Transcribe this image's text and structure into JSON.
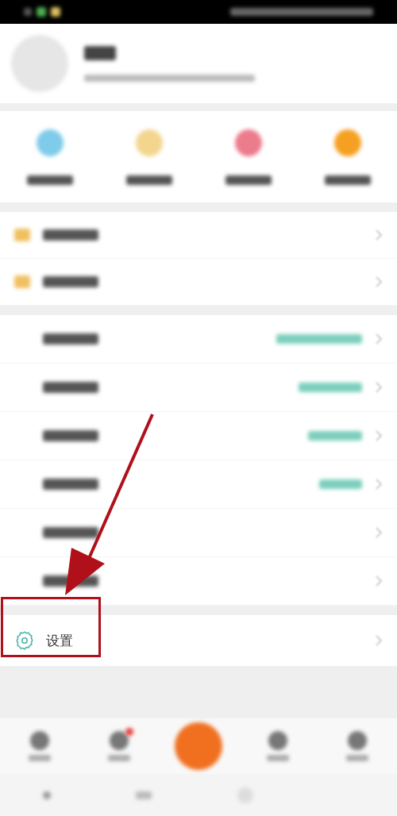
{
  "quick_actions": [
    {
      "color": "#7fcbea"
    },
    {
      "color": "#f3d58e"
    },
    {
      "color": "#ec7b8c"
    },
    {
      "color": "#f5a020"
    }
  ],
  "member_rows": [
    {
      "has_icon": true
    },
    {
      "has_icon": true
    }
  ],
  "menu_rows": [
    {
      "has_value": true
    },
    {
      "has_value": true
    },
    {
      "has_value": true
    },
    {
      "has_value": true
    },
    {
      "has_value": false
    },
    {
      "has_value": false
    }
  ],
  "settings_row": {
    "label": "设置",
    "highlighted": true
  },
  "bottom_nav": [
    {
      "kind": "tab",
      "badge": false
    },
    {
      "kind": "tab",
      "badge": true
    },
    {
      "kind": "center",
      "badge": false
    },
    {
      "kind": "tab",
      "badge": false
    },
    {
      "kind": "tab",
      "badge": false
    }
  ],
  "annotation": {
    "arrow": true
  }
}
